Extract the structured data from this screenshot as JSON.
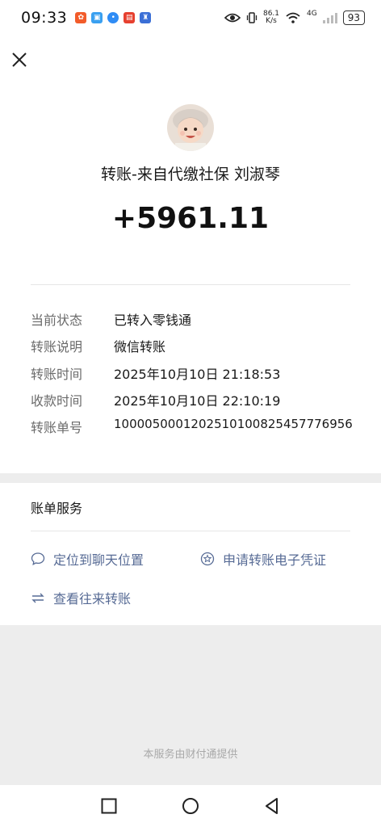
{
  "status_bar": {
    "time": "09:33",
    "net_speed_value": "86.1",
    "net_speed_unit": "K/s",
    "network_type": "4G",
    "battery": "93"
  },
  "transfer": {
    "title": "转账-来自代缴社保 刘淑琴",
    "amount": "+5961.11",
    "details": [
      {
        "label": "当前状态",
        "value": "已转入零钱通"
      },
      {
        "label": "转账说明",
        "value": "微信转账"
      },
      {
        "label": "转账时间",
        "value": "2025年10月10日 21:18:53"
      },
      {
        "label": "收款时间",
        "value": "2025年10月10日 22:10:19"
      },
      {
        "label": "转账单号",
        "value": "1000050001202510100825457776956"
      }
    ]
  },
  "services": {
    "title": "账单服务",
    "locate_chat": "定位到聊天位置",
    "apply_voucher": "申请转账电子凭证",
    "view_history": "查看往来转账"
  },
  "footer": {
    "provider_note": "本服务由财付通提供"
  },
  "colors": {
    "link": "#576b95",
    "background": "#ededed",
    "card": "#ffffff"
  }
}
